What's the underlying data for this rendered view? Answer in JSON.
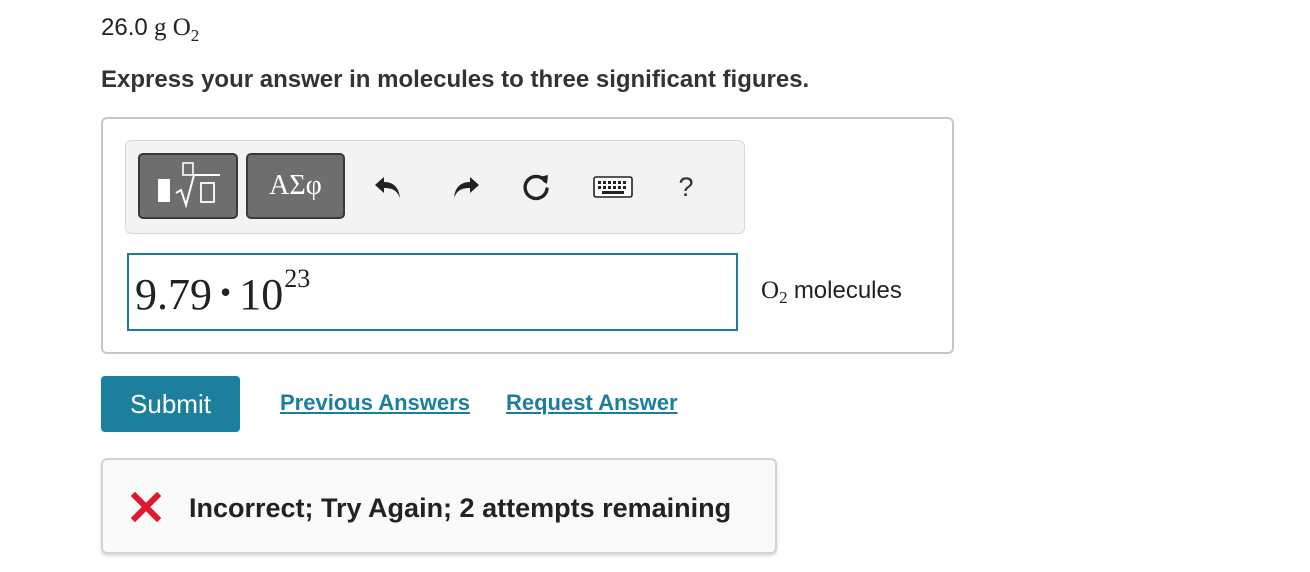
{
  "problem": {
    "mass_value": "26.0",
    "mass_unit": "g",
    "formula_element": "O",
    "formula_subscript": "2"
  },
  "instruction": "Express your answer in molecules to three significant figures.",
  "toolbar": {
    "templates_icon": "templates-icon",
    "symbols_label": "ΑΣφ",
    "undo_icon": "undo-icon",
    "redo_icon": "redo-icon",
    "reset_icon": "reset-icon",
    "keyboard_icon": "keyboard-icon",
    "help_label": "?"
  },
  "answer": {
    "mantissa": "9.79",
    "operator": "•",
    "base": "10",
    "exponent": "23"
  },
  "unit": {
    "element": "O",
    "subscript": "2",
    "word": "molecules"
  },
  "actions": {
    "submit_label": "Submit",
    "previous_answers_label": "Previous Answers",
    "request_answer_label": "Request Answer"
  },
  "feedback": {
    "icon": "incorrect-x-icon",
    "text": "Incorrect; Try Again; 2 attempts remaining"
  },
  "colors": {
    "accent": "#1d7f9e",
    "link": "#1a7e9c",
    "error": "#e0182d",
    "input_border": "#1f7a99"
  }
}
